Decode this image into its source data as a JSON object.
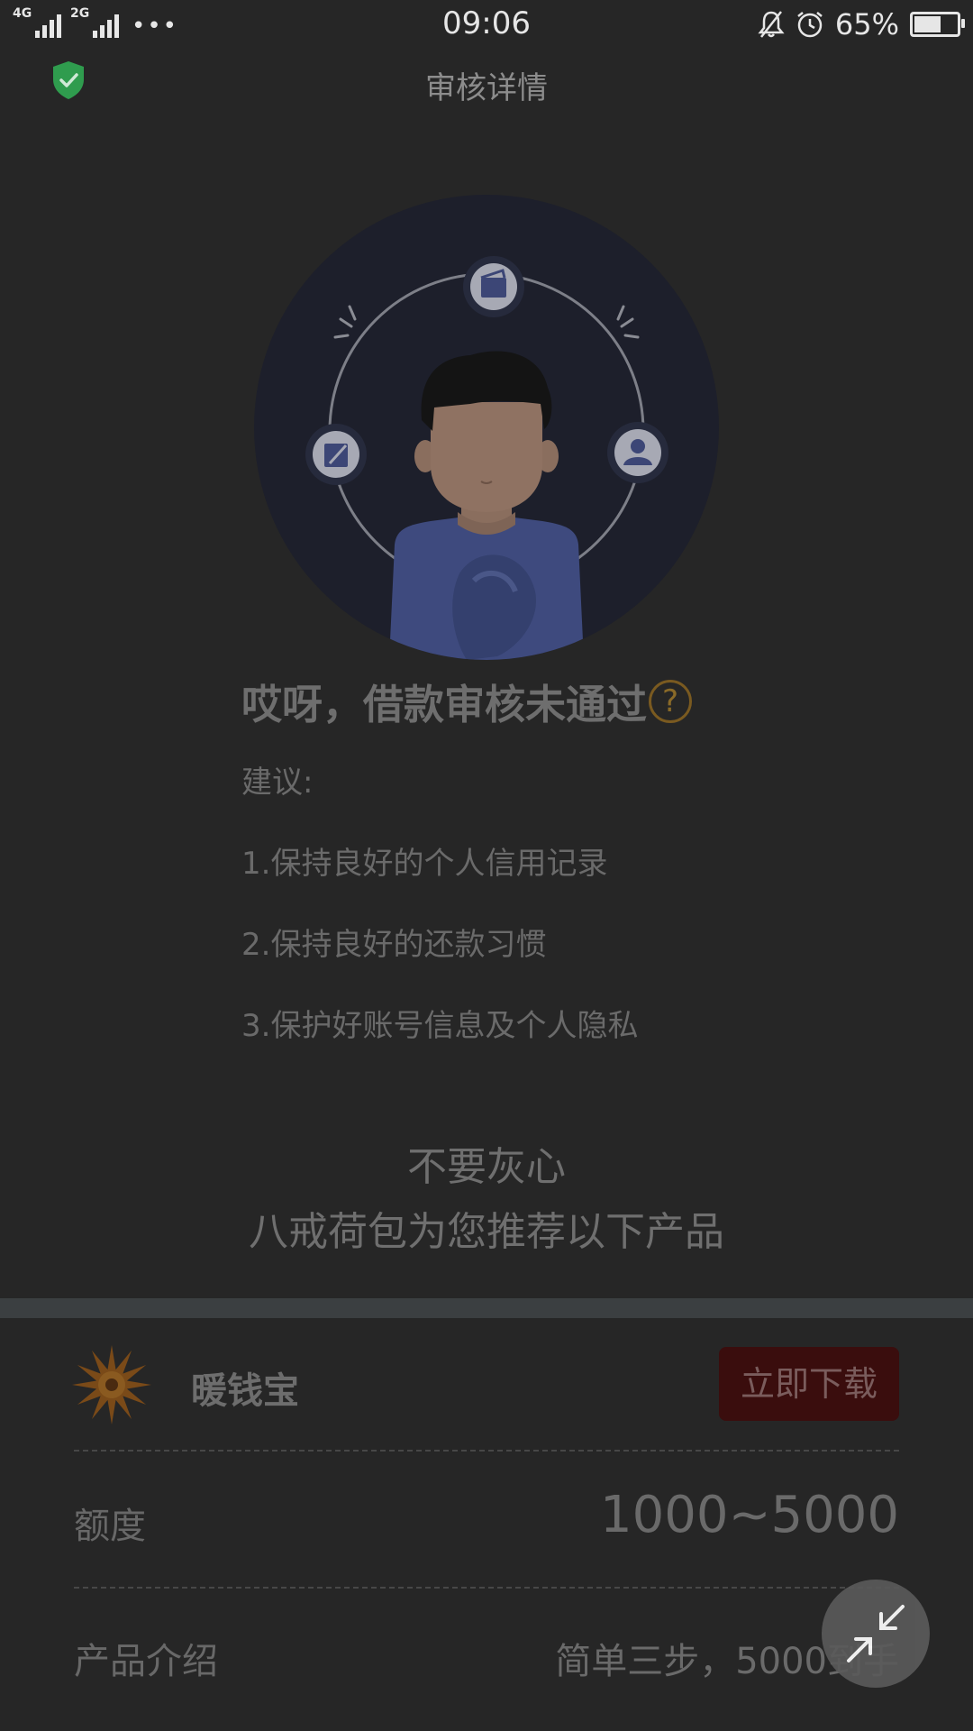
{
  "status_bar": {
    "network1": "4G",
    "network2": "4G",
    "network3": "2G",
    "more": "•••",
    "time": "09:06",
    "battery_percent": "65%",
    "battery_level": 0.65
  },
  "header": {
    "title": "审核详情"
  },
  "result": {
    "headline": "哎呀，借款审核未通过",
    "help_glyph": "?",
    "suggestion_label": "建议:",
    "suggestions": [
      "1.保持良好的个人信用记录",
      "2.保持良好的还款习惯",
      "3.保护好账号信息及个人隐私"
    ]
  },
  "encouragement": {
    "line1": "不要灰心",
    "line2": "八戒荷包为您推荐以下产品"
  },
  "product": {
    "name": "暖钱宝",
    "download_label": "立即下载",
    "quota_label": "额度",
    "quota_value": "1000~5000",
    "intro_label": "产品介绍",
    "intro_value": "简单三步，5000到手"
  },
  "colors": {
    "background": "#262626",
    "download_bg": "#3a0d0d",
    "shield": "#2f9c4e",
    "illustration_bg": "#1d1f2b"
  }
}
